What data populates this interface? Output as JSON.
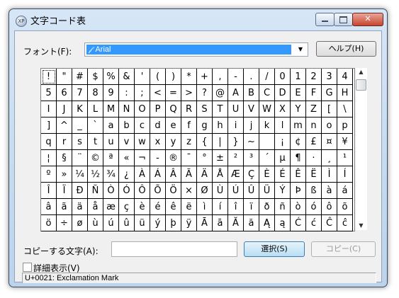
{
  "window": {
    "title": "文字コード表"
  },
  "app_icon_text": "XP",
  "title_buttons": {
    "minimize": "minimize-icon",
    "maximize": "maximize-icon",
    "close_glyph": "✕"
  },
  "font_label": "フォント(F):",
  "font_select": {
    "value": "Arial",
    "icon": "𝒻",
    "arrow": "▼"
  },
  "help_button": "ヘルプ(H)",
  "grid_rows": [
    [
      "!",
      "\"",
      "#",
      "$",
      "%",
      "&",
      "'",
      "(",
      ")",
      "*",
      "+",
      ",",
      "-",
      ".",
      "/",
      "0",
      "1",
      "2",
      "3",
      "4"
    ],
    [
      "5",
      "6",
      "7",
      "8",
      "9",
      ":",
      ";",
      "<",
      "=",
      ">",
      "?",
      "@",
      "A",
      "B",
      "C",
      "D",
      "E",
      "F",
      "G",
      "H"
    ],
    [
      "I",
      "J",
      "K",
      "L",
      "M",
      "N",
      "O",
      "P",
      "Q",
      "R",
      "S",
      "T",
      "U",
      "V",
      "W",
      "X",
      "Y",
      "Z",
      "[",
      "\\"
    ],
    [
      "]",
      "^",
      "_",
      "`",
      "a",
      "b",
      "c",
      "d",
      "e",
      "f",
      "g",
      "h",
      "i",
      "j",
      "k",
      "l",
      "m",
      "n",
      "o",
      "p"
    ],
    [
      "q",
      "r",
      "s",
      "t",
      "u",
      "v",
      "w",
      "x",
      "y",
      "z",
      "{",
      "|",
      "}",
      "~",
      " ",
      "¡",
      "¢",
      "£",
      "¤",
      "¥"
    ],
    [
      "¦",
      "§",
      "¨",
      "©",
      "ª",
      "«",
      "¬",
      "-",
      "®",
      "¯",
      "°",
      "±",
      "²",
      "³",
      "´",
      "µ",
      "¶",
      "·",
      "¸",
      "¹"
    ],
    [
      "º",
      "»",
      "¼",
      "½",
      "¾",
      "¿",
      "À",
      "Á",
      "Â",
      "Ã",
      "Ä",
      "Å",
      "Æ",
      "Ç",
      "È",
      "É",
      "Ê",
      "Ë",
      "Ì",
      "Í"
    ],
    [
      "Î",
      "Ï",
      "Ð",
      "Ñ",
      "Ò",
      "Ó",
      "Ô",
      "Õ",
      "Ö",
      "×",
      "Ø",
      "Ù",
      "Ú",
      "Û",
      "Ü",
      "Ý",
      "Þ",
      "ß",
      "à",
      "á"
    ],
    [
      "â",
      "ã",
      "ä",
      "å",
      "æ",
      "ç",
      "è",
      "é",
      "ê",
      "ë",
      "ì",
      "í",
      "î",
      "ï",
      "ð",
      "ñ",
      "ò",
      "ó",
      "ô",
      "õ"
    ],
    [
      "ö",
      "÷",
      "ø",
      "ù",
      "ú",
      "û",
      "ü",
      "ý",
      "þ",
      "ÿ",
      "Ā",
      "ā",
      "Ă",
      "ă",
      "Ą",
      "ą",
      "Ć",
      "ć",
      "Ĉ",
      "ĉ"
    ]
  ],
  "selected_char": "!",
  "scrollbar": {
    "up": "▲",
    "down": "▼"
  },
  "copy_label": "コピーする文字(A):",
  "copy_value": "",
  "select_button": "選択(S)",
  "copy_button": "コピー(C)",
  "advanced_label": "詳細表示(V)",
  "status_text": "U+0021: Exclamation Mark"
}
